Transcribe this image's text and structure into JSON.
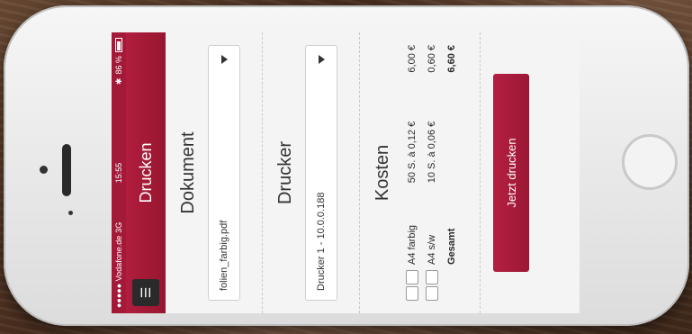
{
  "statusbar": {
    "carrier": "●●●●● Vodafone.de",
    "network": "3G",
    "time": "15:55",
    "battery": "86 %"
  },
  "navbar": {
    "title": "Drucken",
    "menu_glyph": "☰"
  },
  "dokument": {
    "title": "Dokument",
    "selected": "folien_farbig.pdf"
  },
  "drucker": {
    "title": "Drucker",
    "selected": "Drucker 1 - 10.0.0.188"
  },
  "kosten": {
    "title": "Kosten",
    "rows": [
      {
        "label": "A4 farbig",
        "calc": "50 S. à 0,12 €",
        "sum": "6,00 €"
      },
      {
        "label": "A4 s/w",
        "calc": "10 S. à 0,06 €",
        "sum": "0,60 €"
      }
    ],
    "total_label": "Gesamt",
    "total_value": "6,60 €"
  },
  "action": {
    "print_label": "Jetzt drucken"
  },
  "colors": {
    "accent": "#a31a38"
  }
}
